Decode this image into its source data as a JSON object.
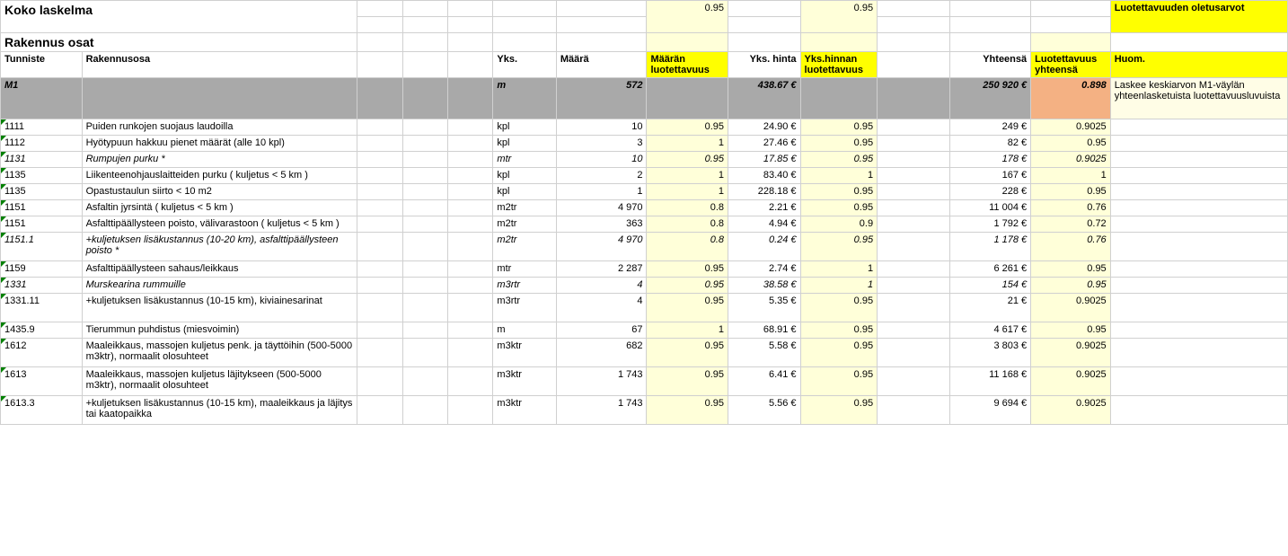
{
  "header": {
    "koko_laskelma": "Koko laskelma",
    "default_q": "0.95",
    "default_p": "0.95",
    "defaults_label": "Luotettavuuden oletusarvot",
    "rakennus_osat": "Rakennus osat"
  },
  "cols": {
    "tunniste": "Tunniste",
    "rakennusosa": "Rakennusosa",
    "yks": "Yks.",
    "maara": "Määrä",
    "maaran_luot": "Määrän luotettavuus",
    "yks_hinta": "Yks. hinta",
    "yks_hinnan_luot": "Yks.hinnan luotettavuus",
    "yhteensa": "Yhteensä",
    "luot_yht": "Luotettavuus yhteensä",
    "huom": "Huom."
  },
  "m1": {
    "id": "M1",
    "unit": "m",
    "qty": "572",
    "uprice": "438.67 €",
    "total": "250 920 €",
    "trel": "0.898",
    "note": "Laskee keskiarvon M1-väylän yhteenlasketuista luotettavuusluvuista"
  },
  "rows": [
    {
      "id": "1111",
      "desc": "Puiden runkojen suojaus laudoilla",
      "unit": "kpl",
      "qty": "10",
      "qrel": "0.95",
      "uprice": "24.90 €",
      "urel": "0.95",
      "total": "249 €",
      "trel": "0.9025",
      "italic": false
    },
    {
      "id": "1112",
      "desc": "Hyötypuun hakkuu pienet määrät (alle 10 kpl)",
      "unit": "kpl",
      "qty": "3",
      "qrel": "1",
      "uprice": "27.46 €",
      "urel": "0.95",
      "total": "82 €",
      "trel": "0.95",
      "italic": false
    },
    {
      "id": "1131",
      "desc": "Rumpujen purku *",
      "unit": "mtr",
      "qty": "10",
      "qrel": "0.95",
      "uprice": "17.85 €",
      "urel": "0.95",
      "total": "178 €",
      "trel": "0.9025",
      "italic": true
    },
    {
      "id": "1135",
      "desc": "Liikenteenohjauslaitteiden purku ( kuljetus < 5 km )",
      "unit": "kpl",
      "qty": "2",
      "qrel": "1",
      "uprice": "83.40 €",
      "urel": "1",
      "total": "167 €",
      "trel": "1",
      "italic": false
    },
    {
      "id": "1135",
      "desc": "Opastustaulun siirto < 10 m2",
      "unit": "kpl",
      "qty": "1",
      "qrel": "1",
      "uprice": "228.18 €",
      "urel": "0.95",
      "total": "228 €",
      "trel": "0.95",
      "italic": false
    },
    {
      "id": "1151",
      "desc": "Asfaltin jyrsintä ( kuljetus < 5 km )",
      "unit": "m2tr",
      "qty": "4 970",
      "qrel": "0.8",
      "uprice": "2.21 €",
      "urel": "0.95",
      "total": "11 004 €",
      "trel": "0.76",
      "italic": false
    },
    {
      "id": "1151",
      "desc": "Asfalttipäällysteen poisto, välivarastoon ( kuljetus < 5 km )",
      "unit": "m2tr",
      "qty": "363",
      "qrel": "0.8",
      "uprice": "4.94 €",
      "urel": "0.9",
      "total": "1 792 €",
      "trel": "0.72",
      "italic": false
    },
    {
      "id": "1151.1",
      "desc": "+kuljetuksen lisäkustannus (10-20 km), asfalttipäällysteen poisto *",
      "unit": "m2tr",
      "qty": "4 970",
      "qrel": "0.8",
      "uprice": "0.24 €",
      "urel": "0.95",
      "total": "1 178 €",
      "trel": "0.76",
      "italic": true,
      "tall": true
    },
    {
      "id": "1159",
      "desc": "Asfalttipäällysteen sahaus/leikkaus",
      "unit": "mtr",
      "qty": "2 287",
      "qrel": "0.95",
      "uprice": "2.74 €",
      "urel": "1",
      "total": "6 261 €",
      "trel": "0.95",
      "italic": false
    },
    {
      "id": "1331",
      "desc": "Murskearina rummuille",
      "unit": "m3rtr",
      "qty": "4",
      "qrel": "0.95",
      "uprice": "38.58 €",
      "urel": "1",
      "total": "154 €",
      "trel": "0.95",
      "italic": true
    },
    {
      "id": "1331.11",
      "desc": "+kuljetuksen lisäkustannus (10-15 km), kiviainesarinat",
      "unit": "m3rtr",
      "qty": "4",
      "qrel": "0.95",
      "uprice": "5.35 €",
      "urel": "0.95",
      "total": "21 €",
      "trel": "0.9025",
      "italic": false,
      "tall": true
    },
    {
      "id": "1435.9",
      "desc": "Tierummun puhdistus (miesvoimin)",
      "unit": "m",
      "qty": "67",
      "qrel": "1",
      "uprice": "68.91 €",
      "urel": "0.95",
      "total": "4 617 €",
      "trel": "0.95",
      "italic": false
    },
    {
      "id": "1612",
      "desc": "Maaleikkaus, massojen kuljetus penk. ja täyttöihin (500-5000 m3ktr), normaalit olosuhteet",
      "unit": "m3ktr",
      "qty": "682",
      "qrel": "0.95",
      "uprice": "5.58 €",
      "urel": "0.95",
      "total": "3 803 €",
      "trel": "0.9025",
      "italic": false,
      "tall": true
    },
    {
      "id": "1613",
      "desc": "Maaleikkaus, massojen kuljetus läjitykseen (500-5000 m3ktr), normaalit olosuhteet",
      "unit": "m3ktr",
      "qty": "1 743",
      "qrel": "0.95",
      "uprice": "6.41 €",
      "urel": "0.95",
      "total": "11 168 €",
      "trel": "0.9025",
      "italic": false,
      "tall": true
    },
    {
      "id": "1613.3",
      "desc": "+kuljetuksen lisäkustannus (10-15 km), maaleikkaus ja läjitys tai kaatopaikka",
      "unit": "m3ktr",
      "qty": "1 743",
      "qrel": "0.95",
      "uprice": "5.56 €",
      "urel": "0.95",
      "total": "9 694 €",
      "trel": "0.9025",
      "italic": false,
      "tall": true
    }
  ]
}
